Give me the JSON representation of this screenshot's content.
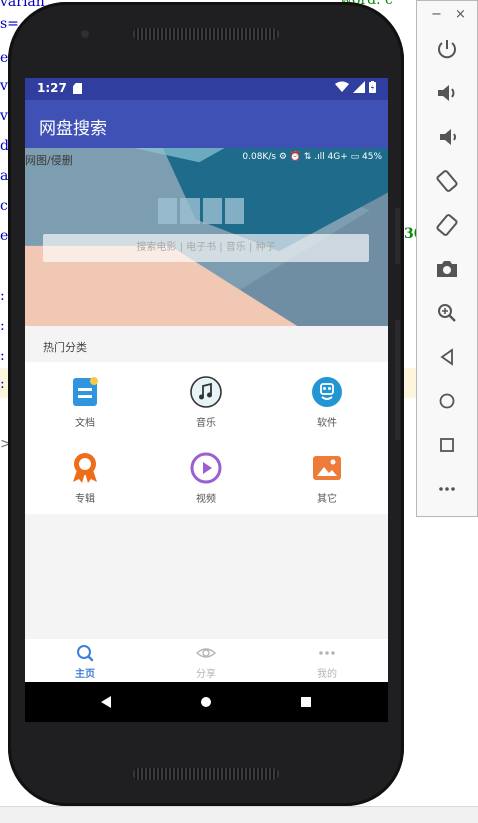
{
  "background_code": {
    "lines": [
      {
        "text": "varian",
        "color": "#0000c0"
      },
      {
        "text": "s=",
        "color": "#0000c0"
      },
      {
        "text": "e",
        "color": "#0000c0"
      },
      {
        "text": "vo",
        "color": "#0000c0"
      },
      {
        "text": "vo",
        "color": "#0000c0"
      },
      {
        "text": "de",
        "color": "#0000c0"
      },
      {
        "text": "av",
        "color": "#0000c0"
      },
      {
        "text": "ch",
        "color": "#0000c0"
      },
      {
        "text": "ex",
        "color": "#0000c0"
      },
      {
        "text": ":",
        "color": "#0000c0"
      },
      {
        "text": ":",
        "color": "#0000c0"
      },
      {
        "text": ":",
        "color": "#0000c0"
      },
      {
        "text": ":",
        "color": "#0000c0"
      },
      {
        "text": ">",
        "color": "#666666"
      }
    ],
    "right_fragment": "30",
    "top_right_fragment": "word. c"
  },
  "status_bar": {
    "time": "1:27",
    "right_icons": [
      "wifi-icon",
      "signal-icon",
      "battery-icon"
    ]
  },
  "app_bar": {
    "title": "网盘搜索"
  },
  "banner": {
    "tag": "网图/侵删",
    "status_text": "0.08K/s ⚙ ⏰ ⇅ .ıll 4G+ ▭ 45%",
    "search_placeholder": "搜索电影 | 电子书 | 音乐 | 种子"
  },
  "categories": {
    "header": "热门分类",
    "items": [
      {
        "label": "文档",
        "icon": "document-icon",
        "color": "#2f95e0"
      },
      {
        "label": "音乐",
        "icon": "music-icon",
        "color": "#333333"
      },
      {
        "label": "软件",
        "icon": "software-icon",
        "color": "#2196d3"
      },
      {
        "label": "专辑",
        "icon": "album-icon",
        "color": "#ef6c1a"
      },
      {
        "label": "视频",
        "icon": "video-icon",
        "color": "#9b5fd1"
      },
      {
        "label": "其它",
        "icon": "image-icon",
        "color": "#ef7b3a"
      }
    ]
  },
  "bottom_nav": {
    "items": [
      {
        "label": "主页",
        "icon": "search-icon",
        "active": true
      },
      {
        "label": "分享",
        "icon": "eye-icon",
        "active": false
      },
      {
        "label": "我的",
        "icon": "more-icon",
        "active": false
      }
    ]
  },
  "emulator_toolbar": {
    "window_controls": [
      "minimize-icon",
      "close-icon"
    ],
    "minimize_glyph": "−",
    "close_glyph": "×",
    "buttons": [
      "power-icon",
      "volume-up-icon",
      "volume-down-icon",
      "rotate-left-icon",
      "rotate-right-icon",
      "camera-icon",
      "zoom-icon",
      "back-icon",
      "home-icon",
      "overview-icon",
      "more-icon"
    ]
  },
  "colors": {
    "status_bar": "#303f9f",
    "app_bar": "#3f51b5",
    "active_tab": "#3f7fd9"
  }
}
